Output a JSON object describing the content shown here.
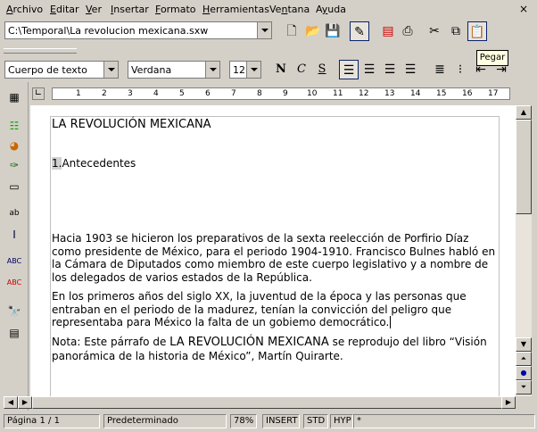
{
  "menu": [
    "Archivo",
    "Editar",
    "Ver",
    "Insertar",
    "Formato",
    "Herramientas",
    "Ventana",
    "Ayuda"
  ],
  "menu_underline": [
    "A",
    "E",
    "V",
    "I",
    "F",
    "H",
    "n",
    "y"
  ],
  "window_close": "×",
  "url": "C:\\Temporal\\La revolucion mexicana.sxw",
  "toolbar": {
    "paragraph_style": "Cuerpo de texto",
    "font_name": "Verdana",
    "font_size": "12",
    "bold": "N",
    "italic": "C",
    "underline": "S"
  },
  "tooltip": "Pegar",
  "ruler_numbers": [
    "1",
    "2",
    "3",
    "4",
    "5",
    "6",
    "7",
    "8",
    "9",
    "10",
    "11",
    "12",
    "13",
    "14",
    "15",
    "16",
    "17"
  ],
  "document": {
    "title": "LA REVOLUCIÓN MEXICANA",
    "heading_num": "1.",
    "heading": "Antecedentes",
    "p1": "Hacia 1903 se hicieron los preparativos de la sexta reelección de Porfirio Díaz como presidente de México, para el periodo 1904-1910. Francisco Bulnes habló en la Cámara de Diputados como miembro de este cuerpo legislativo y a nombre de los delegados de varios estados de la República.",
    "p2": "En los primeros años del siglo XX, la juventud de la época y las personas que entraban en el periodo de la madurez, tenían la convicción del peligro que representaba para México la falta de un gobiemo democrático.",
    "p3_a": "Nota: Este párrafo de ",
    "p3_b": "LA REVOLUCIÓN MEXICANA",
    "p3_c": " se reprodujo del libro “Visión panorámica de la historia de México”, Martín Quirarte."
  },
  "status": {
    "page": "Página  1 / 1",
    "style": "Predeterminado",
    "zoom": "78%",
    "insert": "INSERT",
    "std": "STD",
    "hyp": "HYP",
    "mod": "*"
  }
}
